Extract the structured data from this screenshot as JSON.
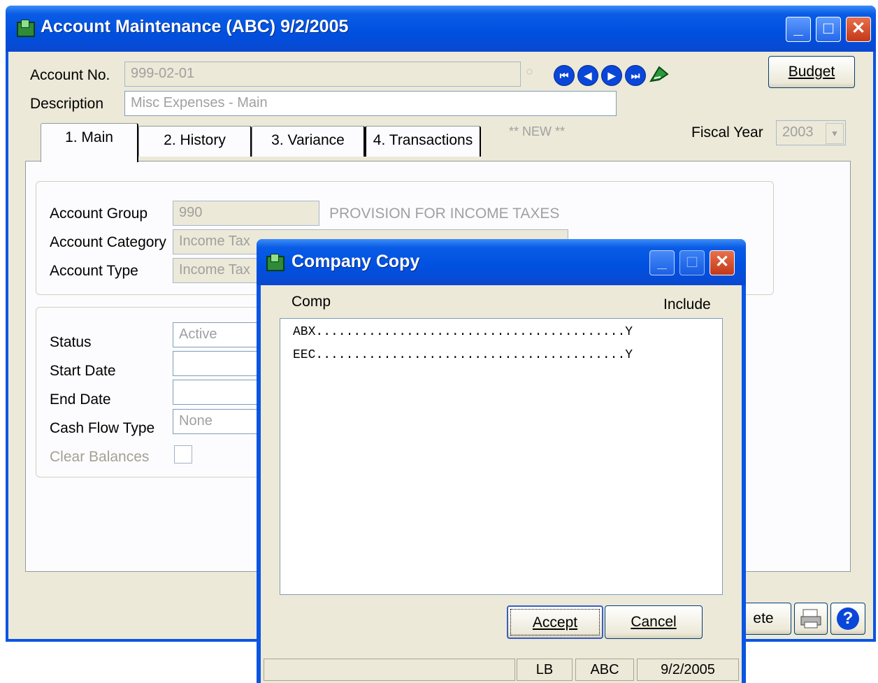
{
  "main_window": {
    "title": "Account Maintenance (ABC) 9/2/2005",
    "account_no_label": "Account No.",
    "account_no_value": "999-02-01",
    "description_label": "Description",
    "description_value": "Misc Expenses - Main",
    "budget_button": "Budget",
    "tabs": [
      "1. Main",
      "2. History",
      "3. Variance",
      "4. Transactions"
    ],
    "new_indicator": "** NEW **",
    "fiscal_year_label": "Fiscal Year",
    "fiscal_year_value": "2003",
    "account_group_label": "Account Group",
    "account_group_value": "990",
    "account_group_desc": "PROVISION FOR INCOME TAXES",
    "account_category_label": "Account Category",
    "account_category_value": "Income Tax",
    "account_type_label": "Account Type",
    "account_type_value": "Income Tax",
    "status_label": "Status",
    "status_value": "Active",
    "start_date_label": "Start Date",
    "start_date_value": "",
    "end_date_label": "End Date",
    "end_date_value": "",
    "cash_flow_label": "Cash Flow Type",
    "cash_flow_value": "None",
    "clear_balances_label": "Clear Balances",
    "delete_button_partial": "ete"
  },
  "dialog": {
    "title": "Company Copy",
    "col_comp": "Comp",
    "col_include": "Include",
    "rows": [
      {
        "text": "ABX.........................................Y"
      },
      {
        "text": "EEC.........................................Y"
      }
    ],
    "accept_button": "Accept",
    "cancel_button": "Cancel",
    "status": [
      "",
      "LB",
      "ABC",
      "9/2/2005"
    ]
  },
  "icons": [
    "app-icon",
    "lookup-icon",
    "first-record-icon",
    "previous-record-icon",
    "next-record-icon",
    "last-record-icon",
    "new-record-icon",
    "print-icon",
    "help-icon",
    "minimize-icon",
    "maximize-icon",
    "close-icon",
    "dropdown-arrow-icon"
  ]
}
